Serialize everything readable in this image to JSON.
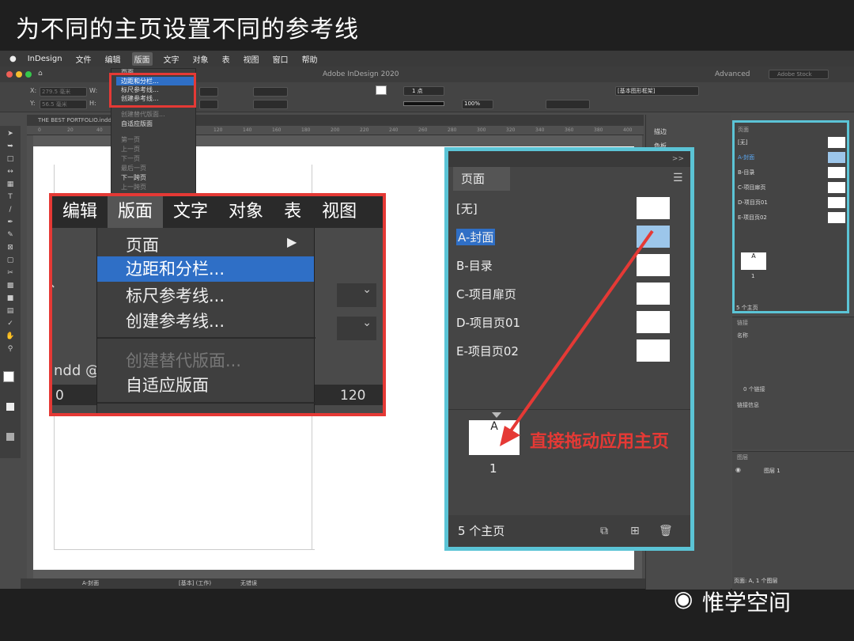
{
  "slide_title": "为不同的主页设置不同的参考线",
  "menubar": {
    "items": [
      "InDesign",
      "文件",
      "编辑",
      "版面",
      "文字",
      "对象",
      "表",
      "视图",
      "窗口",
      "帮助"
    ],
    "active": "版面"
  },
  "app": {
    "window_title": "Adobe InDesign 2020",
    "workspace": "Advanced",
    "search_placeholder": "Adobe Stock",
    "doc_tab": "THE BEST PORTFOLIO.indd @",
    "stroke_weight": "1 点",
    "zoom_pct": "100%",
    "style_name": "[基本图形框架]",
    "x_label": "X:",
    "y_label": "Y:",
    "w_label": "W:",
    "h_label": "H:",
    "x_val": "279.5 毫米",
    "y_val": "56.5 毫米"
  },
  "ruler_ticks": [
    "0",
    "20",
    "40",
    "60",
    "80",
    "100",
    "120",
    "140",
    "160",
    "180",
    "200",
    "220",
    "240",
    "260",
    "280",
    "300",
    "320",
    "340",
    "360",
    "380",
    "400"
  ],
  "small_menu": {
    "items": [
      "页面",
      "边距和分栏...",
      "标尺参考线...",
      "创建参考线...",
      "创建替代版面...",
      "自适应版面",
      "第一页",
      "上一页",
      "下一页",
      "最后一页",
      "下一跨页",
      "上一跨页"
    ]
  },
  "zoom_menu": {
    "menubar": [
      "编辑",
      "版面",
      "文字",
      "对象",
      "表",
      "视图"
    ],
    "active": "版面",
    "items": [
      "页面",
      "边距和分栏...",
      "标尺参考线...",
      "创建参考线...",
      "创建替代版面...",
      "自适应版面"
    ],
    "sub_arrow": "▶",
    "left_fragment": "ndd @",
    "ruler_left": "0",
    "ruler_right": "120"
  },
  "big_pages": {
    "tab": "页面",
    "collapse": ">>",
    "rows": [
      "[无]",
      "A-封面",
      "B-目录",
      "C-项目扉页",
      "D-项目页01",
      "E-项目页02"
    ],
    "selected": "A-封面",
    "page_master_letter": "A",
    "page_number": "1",
    "footer": "5 个主页",
    "annotation": "直接拖动应用主页"
  },
  "small_pages": {
    "tab": "页面",
    "rows": [
      "[无]",
      "A-封面",
      "B-目录",
      "C-项目扉页",
      "D-项目页01",
      "E-项目页02"
    ],
    "footer": "5 个主页",
    "page_master_letter": "A",
    "page_number": "1"
  },
  "right_dock": {
    "items": [
      "描边",
      "色板"
    ]
  },
  "links_panel": {
    "tab": "链接",
    "header": "名称",
    "count": "0 个链接",
    "info": "链接信息"
  },
  "layers_panel": {
    "tab": "图层",
    "layer": "图层 1",
    "footer": "页面: A, 1 个图层"
  },
  "statusbar": {
    "page": "A-封面",
    "style": "[基本] (工作)",
    "errors": "无错误"
  },
  "watermark": "惟学空间",
  "colors": {
    "red_box": "#e53935",
    "cyan_box": "#5bc4d6",
    "menu_select": "#2f6fc6"
  }
}
